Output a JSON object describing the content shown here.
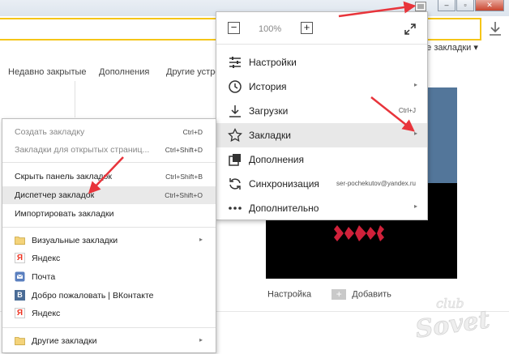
{
  "header": {
    "bookmarks_label_right": "ие закладки ▾"
  },
  "tabs": [
    {
      "label": "Недавно закрытые"
    },
    {
      "label": "Дополнения"
    },
    {
      "label": "Другие устро"
    }
  ],
  "main_menu": {
    "zoom": {
      "minus": "−",
      "value": "100%",
      "plus": "+"
    },
    "items": [
      {
        "label": "Настройки",
        "icon": "settings-icon"
      },
      {
        "label": "История",
        "icon": "history-icon",
        "arrow": "▸"
      },
      {
        "label": "Загрузки",
        "icon": "download-icon",
        "shortcut": "Ctrl+J"
      },
      {
        "label": "Закладки",
        "icon": "star-icon",
        "arrow": "▸"
      },
      {
        "label": "Дополнения",
        "icon": "extensions-icon"
      },
      {
        "label": "Синхронизация",
        "icon": "sync-icon",
        "shortcut": "ser-pochekutov@yandex.ru"
      },
      {
        "label": "Дополнительно",
        "icon": "more-icon",
        "arrow": "▸"
      }
    ]
  },
  "bookmarks_menu": {
    "items": [
      {
        "label": "Создать закладку",
        "shortcut": "Ctrl+D"
      },
      {
        "label": "Закладки для открытых страниц...",
        "shortcut": "Ctrl+Shift+D"
      },
      {
        "label": "Скрыть панель закладок",
        "shortcut": "Ctrl+Shift+B"
      },
      {
        "label": "Диспетчер закладок",
        "shortcut": "Ctrl+Shift+O"
      },
      {
        "label": "Импортировать закладки"
      },
      {
        "label": "Визуальные закладки",
        "arrow": "▸"
      },
      {
        "label": "Яндекс",
        "icon_char": "Я"
      },
      {
        "label": "Почта"
      },
      {
        "label": "Добро пожаловать | ВКонтакте",
        "icon_char": "В"
      },
      {
        "label": "Яндекс",
        "icon_char": "Я"
      },
      {
        "label": "Другие закладки",
        "arrow": "▸"
      }
    ]
  },
  "page": {
    "settings_link": "Настройка",
    "add_plus": "+",
    "add_link": "Добавить"
  },
  "watermark": {
    "line1": "club",
    "line2": "Sovet"
  },
  "colors": {
    "accent_yellow": "#f5c518",
    "arrow_red": "#e8343b",
    "tile_blue": "#53769a"
  }
}
